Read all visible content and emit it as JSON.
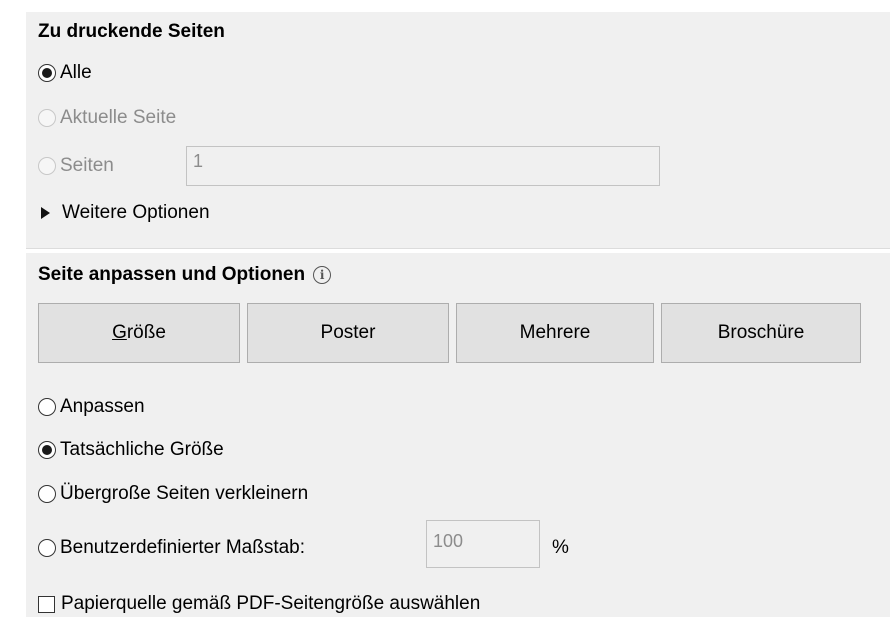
{
  "pages_section": {
    "heading": "Zu druckende Seiten",
    "option_all": "Alle",
    "option_current": "Aktuelle Seite",
    "option_pages": "Seiten",
    "pages_value": "1",
    "more_options": "Weitere Optionen"
  },
  "fit_section": {
    "heading": "Seite anpassen und Optionen",
    "info_glyph": "i",
    "tabs": [
      "Größe",
      "Poster",
      "Mehrere",
      "Broschüre"
    ],
    "options": {
      "fit": "Anpassen",
      "actual_size": "Tatsächliche Größe",
      "shrink_oversized": "Übergroße Seiten verkleinern",
      "custom_scale": "Benutzerdefinierter Maßstab:"
    },
    "custom_scale_value": "100",
    "percent_label": "%",
    "paper_source_label": "Papierquelle gemäß PDF-Seitengröße auswählen"
  }
}
